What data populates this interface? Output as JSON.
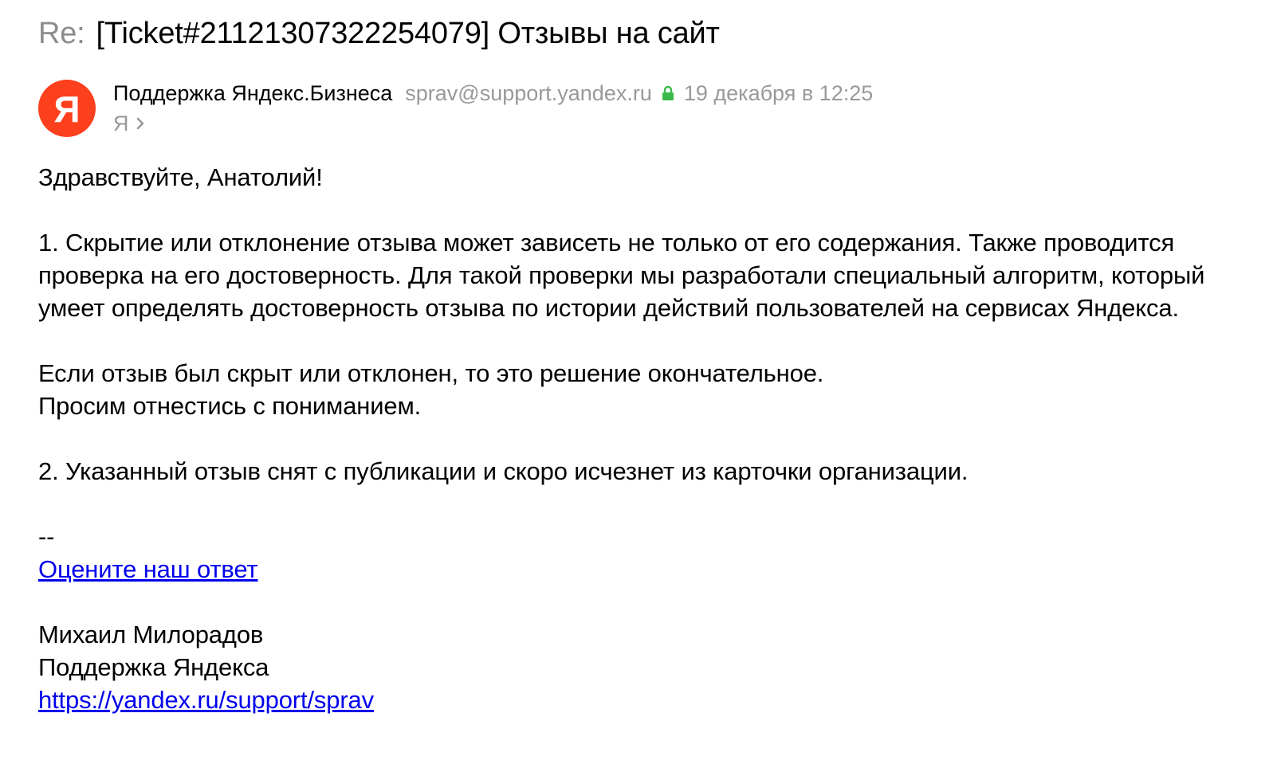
{
  "email": {
    "subject_prefix": "Re:",
    "subject_title": "[Ticket#21121307322254079] Отзывы на сайт",
    "avatar_letter": "Я",
    "sender_name": "Поддержка Яндекс.Бизнеса",
    "sender_email": "sprav@support.yandex.ru",
    "date": "19 декабря в 12:25",
    "recipient": "Я",
    "body": {
      "greeting": "Здравствуйте, Анатолий!",
      "p1": "1. Скрытие или отклонение отзыва может зависеть не только от его содержания. Также проводится проверка на его достоверность. Для такой проверки мы разработали специальный алгоритм, который умеет определять достоверность отзыва по истории действий пользователей на сервисах Яндекса.",
      "p2_line1": "Если отзыв был скрыт или отклонен, то это решение окончательное.",
      "p2_line2": "Просим отнестись с пониманием.",
      "p3": "2. Указанный отзыв снят с публикации и скоро исчезнет из карточки организации.",
      "separator": "--",
      "rate_link": "Оцените наш ответ",
      "signature_name": "Михаил Милорадов",
      "signature_team": "Поддержка Яндекса",
      "signature_url": "https://yandex.ru/support/sprav"
    }
  },
  "colors": {
    "muted": "#999999",
    "brand": "#fc3f1d",
    "lock": "#3cb94b",
    "link": "#0000ee"
  },
  "icons": {
    "lock": "lock-icon",
    "chevron": "chevron-right-icon"
  }
}
